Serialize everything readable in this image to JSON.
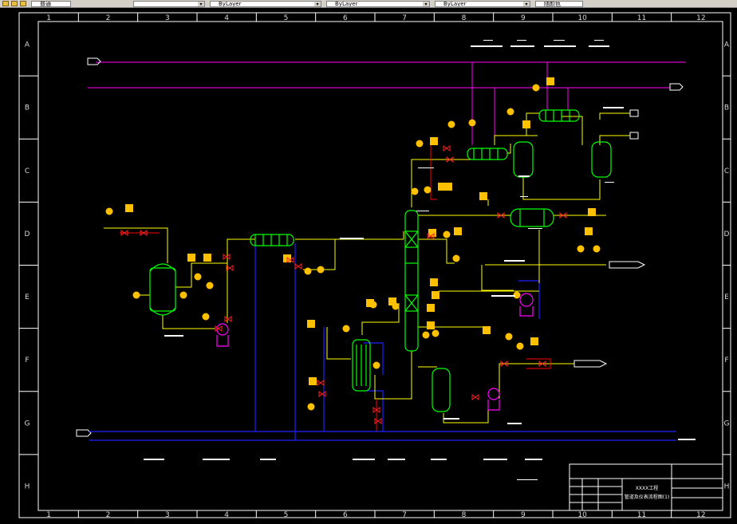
{
  "toolbar": {
    "layer_combo": "ByLayer",
    "linetype_combo": "ByLayer",
    "lineweight_combo": "ByLayer",
    "plot_style": "随颜色",
    "text_style_left": "普通"
  },
  "ruler": {
    "columns": [
      "1",
      "2",
      "3",
      "4",
      "5",
      "6",
      "7",
      "8",
      "9",
      "10",
      "11",
      "12"
    ],
    "rows": [
      "A",
      "B",
      "C",
      "D",
      "E",
      "F",
      "G",
      "H"
    ]
  },
  "title_block": {
    "company": "XXXX工程",
    "drawing_title": "管道及仪表流程图(1)"
  },
  "colors": {
    "background": "#000000",
    "frame": "#ffffff",
    "process_line": "#ffff00",
    "equipment": "#00ff00",
    "steam_line": "#ff00ff",
    "water_line": "#0000ff",
    "valve": "#ff0000",
    "instrument": "#ffc000"
  }
}
